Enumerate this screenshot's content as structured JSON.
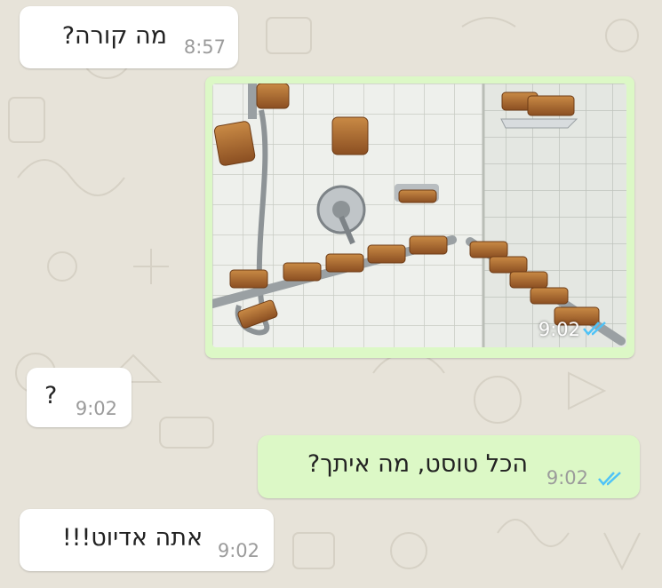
{
  "colors": {
    "incoming_bubble": "#ffffff",
    "outgoing_bubble": "#dcf8c6",
    "read_ticks": "#4fc3f7",
    "timestamp": "#9b9b9b",
    "wallpaper": "#e7e3d9"
  },
  "icons": {
    "read_receipt": "double-check-icon",
    "photo": "toast-in-shower-photo"
  },
  "messages": [
    {
      "direction": "incoming",
      "text": "מה קורה?",
      "time": "8:57"
    },
    {
      "direction": "outgoing",
      "type": "image",
      "time": "9:02",
      "status": "read"
    },
    {
      "direction": "incoming",
      "text": "?",
      "time": "9:02"
    },
    {
      "direction": "outgoing",
      "text": "הכל טוסט, מה איתך?",
      "time": "9:02",
      "status": "read"
    },
    {
      "direction": "incoming",
      "text": "אתה אדיוט!!!",
      "time": "9:02"
    }
  ]
}
